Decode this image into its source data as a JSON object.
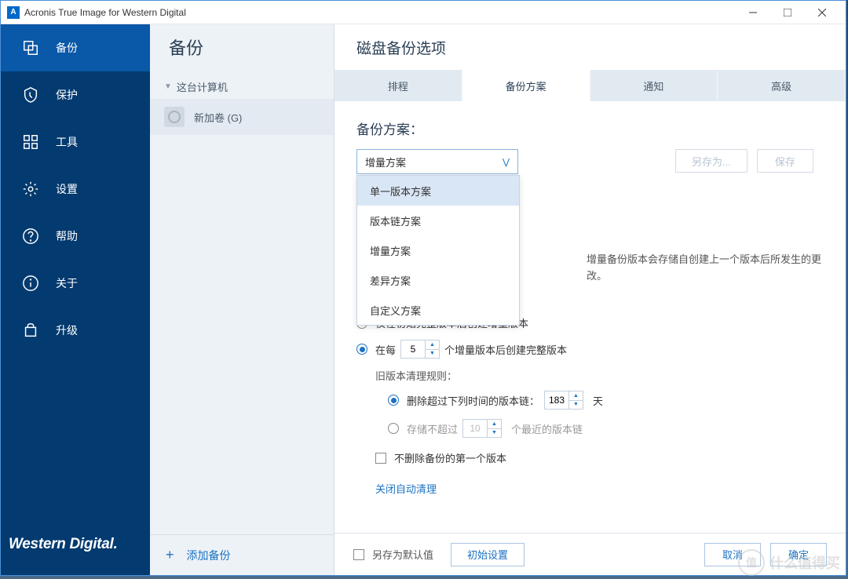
{
  "window": {
    "title": "Acronis True Image for Western Digital"
  },
  "sidebar": {
    "items": [
      {
        "label": "备份"
      },
      {
        "label": "保护"
      },
      {
        "label": "工具"
      },
      {
        "label": "设置"
      },
      {
        "label": "帮助"
      },
      {
        "label": "关于"
      },
      {
        "label": "升级"
      }
    ],
    "logo": "Western Digital."
  },
  "backupList": {
    "heading": "备份",
    "treeRoot": "这台计算机",
    "items": [
      {
        "name": "新加卷 (G)"
      }
    ],
    "addLabel": "添加备份"
  },
  "options": {
    "heading": "磁盘备份选项",
    "tabs": [
      {
        "label": "排程"
      },
      {
        "label": "备份方案"
      },
      {
        "label": "通知"
      },
      {
        "label": "高级"
      }
    ],
    "schemeLabel": "备份方案：",
    "selected": "增量方案",
    "dropdownOptions": [
      "单一版本方案",
      "版本链方案",
      "增量方案",
      "差异方案",
      "自定义方案"
    ],
    "saveAs": "另存为...",
    "save": "保存",
    "description": "增量备份版本会存储自创建上一个版本后所发生的更改。",
    "radio1": "仅在初始完整版本后创建增量版本",
    "radio2a": "在每",
    "radio2val": "5",
    "radio2b": "个增量版本后创建完整版本",
    "cleanupLabel": "旧版本清理规则：",
    "clean1a": "删除超过下列时间的版本链：",
    "clean1val": "183",
    "clean1b": "天",
    "clean2a": "存储不超过",
    "clean2val": "10",
    "clean2b": "个最近的版本链",
    "noDeleteFirst": "不删除备份的第一个版本",
    "closeAuto": "关闭自动清理"
  },
  "footer": {
    "saveDefault": "另存为默认值",
    "initial": "初始设置",
    "cancel": "取消",
    "ok": "确定"
  },
  "watermark": {
    "char": "值",
    "text": "什么值得买"
  }
}
